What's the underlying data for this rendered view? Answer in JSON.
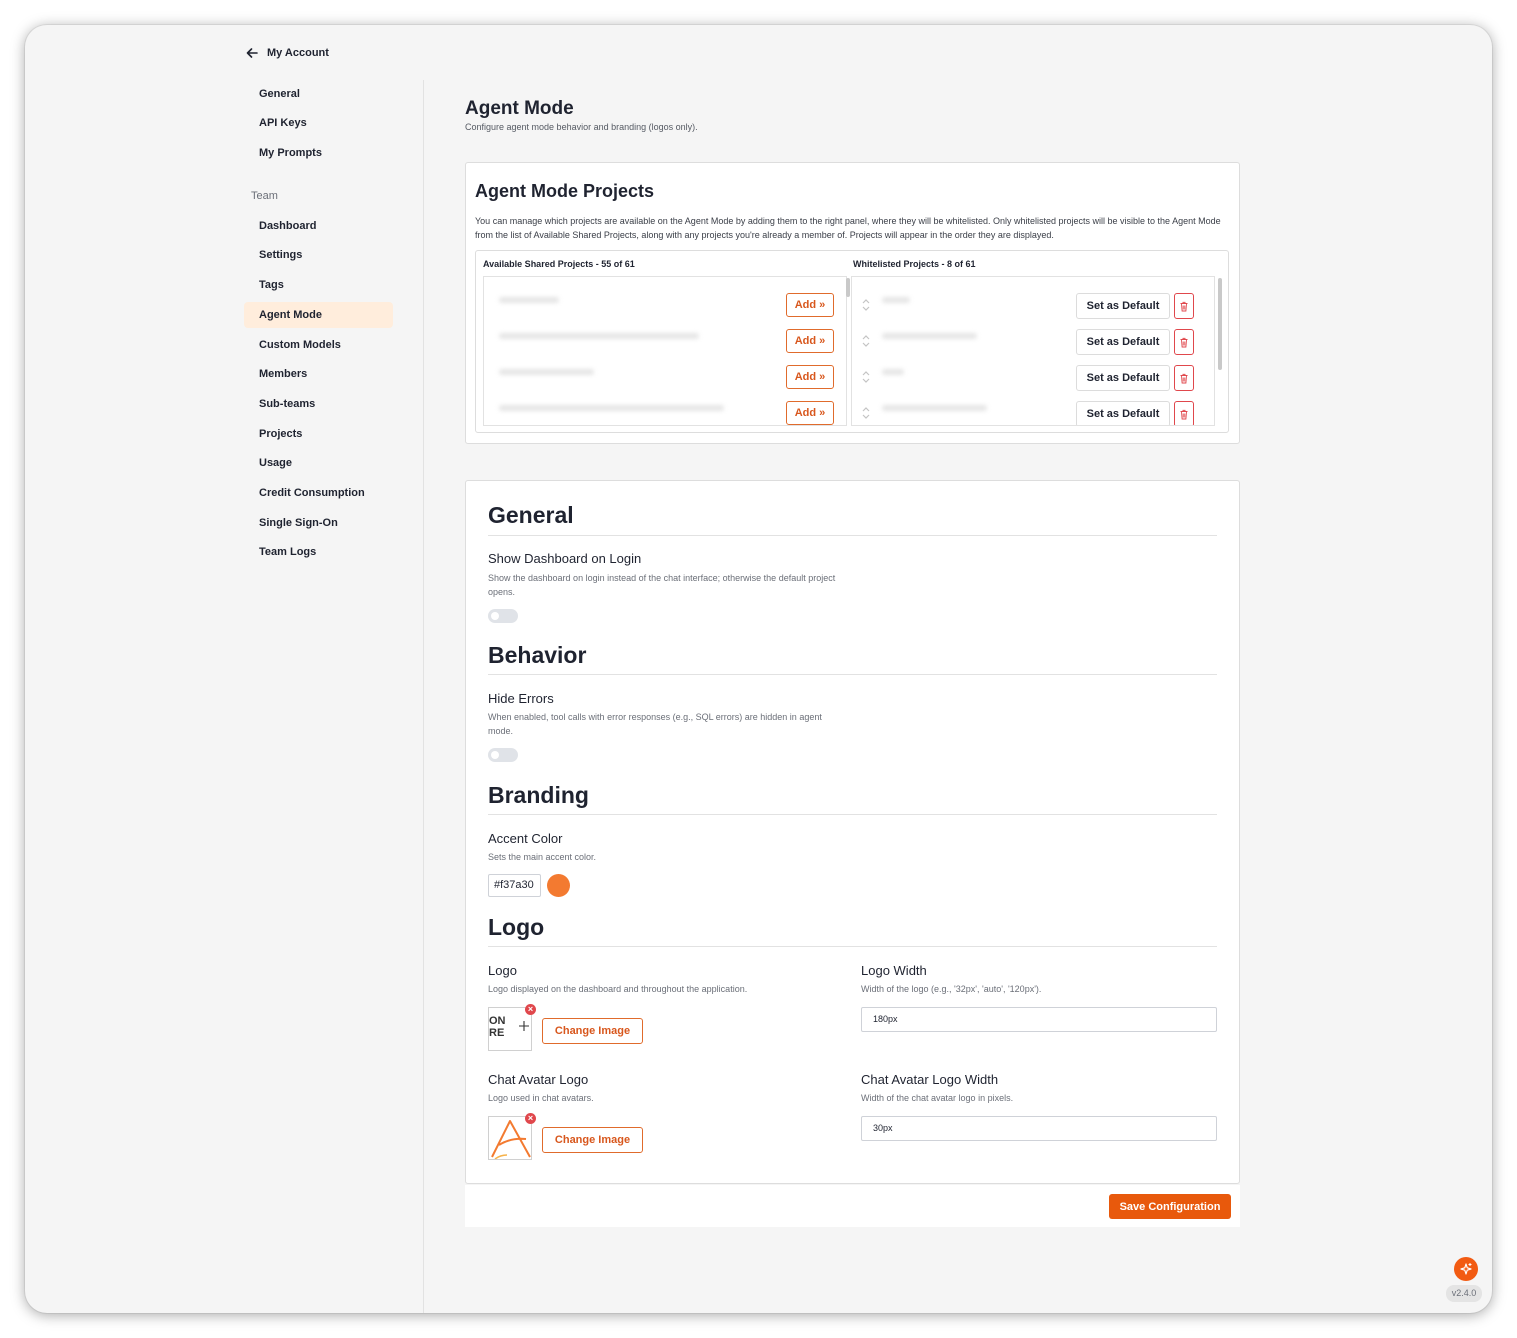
{
  "nav": {
    "back_label": "My Account",
    "account_items": [
      {
        "label": "General"
      },
      {
        "label": "API Keys"
      },
      {
        "label": "My Prompts"
      }
    ],
    "team_heading": "Team",
    "team_items": [
      {
        "label": "Dashboard"
      },
      {
        "label": "Settings"
      },
      {
        "label": "Tags"
      },
      {
        "label": "Agent Mode",
        "active": true
      },
      {
        "label": "Custom Models"
      },
      {
        "label": "Members"
      },
      {
        "label": "Sub-teams"
      },
      {
        "label": "Projects"
      },
      {
        "label": "Usage"
      },
      {
        "label": "Credit Consumption"
      },
      {
        "label": "Single Sign-On"
      },
      {
        "label": "Team Logs"
      }
    ]
  },
  "page": {
    "title": "Agent Mode",
    "subtitle": "Configure agent mode behavior and branding (logos only)."
  },
  "projects": {
    "title": "Agent Mode Projects",
    "description": "You can manage which projects are available on the Agent Mode by adding them to the right panel, where they will be whitelisted. Only whitelisted projects will be visible to the Agent Mode from the list of Available Shared Projects, along with any projects you're already a member of. Projects will appear in the order they are displayed.",
    "available_title": "Available Shared Projects - 55 of 61",
    "whitelisted_title": "Whitelisted Projects - 8 of 61",
    "add_label": "Add »",
    "set_default_label": "Set as Default"
  },
  "general": {
    "title": "General",
    "show_dashboard_label": "Show Dashboard on Login",
    "show_dashboard_desc": "Show the dashboard on login instead of the chat interface; otherwise the default project opens.",
    "show_dashboard_enabled": false
  },
  "behavior": {
    "title": "Behavior",
    "hide_errors_label": "Hide Errors",
    "hide_errors_desc": "When enabled, tool calls with error responses (e.g., SQL errors) are hidden in agent mode.",
    "hide_errors_enabled": false
  },
  "branding": {
    "title": "Branding",
    "accent_label": "Accent Color",
    "accent_desc": "Sets the main accent color.",
    "accent_value": "#f37a30"
  },
  "logo": {
    "title": "Logo",
    "logo_label": "Logo",
    "logo_desc": "Logo displayed on the dashboard and throughout the application.",
    "logo_thumb_text_1": "ON",
    "logo_thumb_text_2": "RE",
    "change_image_label": "Change Image",
    "width_label": "Logo Width",
    "width_desc": "Width of the logo (e.g., '32px', 'auto', '120px').",
    "width_value": "180px",
    "avatar_label": "Chat Avatar Logo",
    "avatar_desc": "Logo used in chat avatars.",
    "avatar_width_label": "Chat Avatar Logo Width",
    "avatar_width_desc": "Width of the chat avatar logo in pixels.",
    "avatar_width_value": "30px"
  },
  "footer": {
    "save_label": "Save Configuration",
    "version": "v2.4.0"
  },
  "colors": {
    "accent": "#f37a30",
    "primary_button": "#e8590c",
    "active_nav_bg": "#ffeddc",
    "delete_red": "#e0474c"
  },
  "icons": {
    "back": "arrow-left-icon",
    "delete": "trash-icon",
    "drag": "drag-handle-icon",
    "remove": "close-icon",
    "upload": "plus-icon",
    "assistant": "sparkle-icon"
  }
}
